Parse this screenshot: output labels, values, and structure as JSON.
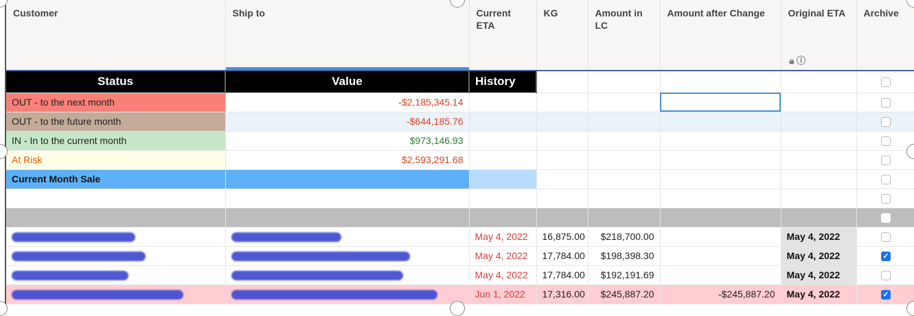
{
  "columns": [
    "Customer",
    "Ship to",
    "Current ETA",
    "KG",
    "Amount in LC",
    "Amount after Change",
    "Original ETA",
    "Archive"
  ],
  "summary": {
    "headers": {
      "status": "Status",
      "value": "Value",
      "history": "History"
    },
    "rows": [
      {
        "status": "OUT - to the next month",
        "value": "-$2,185,345.14"
      },
      {
        "status": "OUT - to the future month",
        "value": "-$644,185.76"
      },
      {
        "status": "IN - In to the current month",
        "value": "$973,146.93"
      },
      {
        "status": "At Risk",
        "value": "$2,593,291.68"
      },
      {
        "status": "Current Month Sale",
        "value": ""
      }
    ]
  },
  "rows": [
    {
      "current_eta": "May 4, 2022",
      "kg": "16,875.00",
      "amount_lc": "$218,700.00",
      "amount_after": "",
      "original_eta": "May 4, 2022",
      "archive": false
    },
    {
      "current_eta": "May 4, 2022",
      "kg": "17,784.00",
      "amount_lc": "$198,398.30",
      "amount_after": "",
      "original_eta": "May 4, 2022",
      "archive": true
    },
    {
      "current_eta": "May 4, 2022",
      "kg": "17,784.00",
      "amount_lc": "$192,191.69",
      "amount_after": "",
      "original_eta": "May 4, 2022",
      "archive": false
    },
    {
      "current_eta": "Jun 1, 2022",
      "kg": "17,316.00",
      "amount_lc": "$245,887.20",
      "amount_after": "-$245,887.20",
      "original_eta": "May 4, 2022",
      "archive": true
    }
  ],
  "colors": {
    "out_next": "#f88078",
    "out_future": "#c4ab98",
    "in_current": "#c6e6c8",
    "at_risk": "#fffde6",
    "current_sale": "#5db0f5",
    "highlight_row": "#ffcdd2"
  }
}
